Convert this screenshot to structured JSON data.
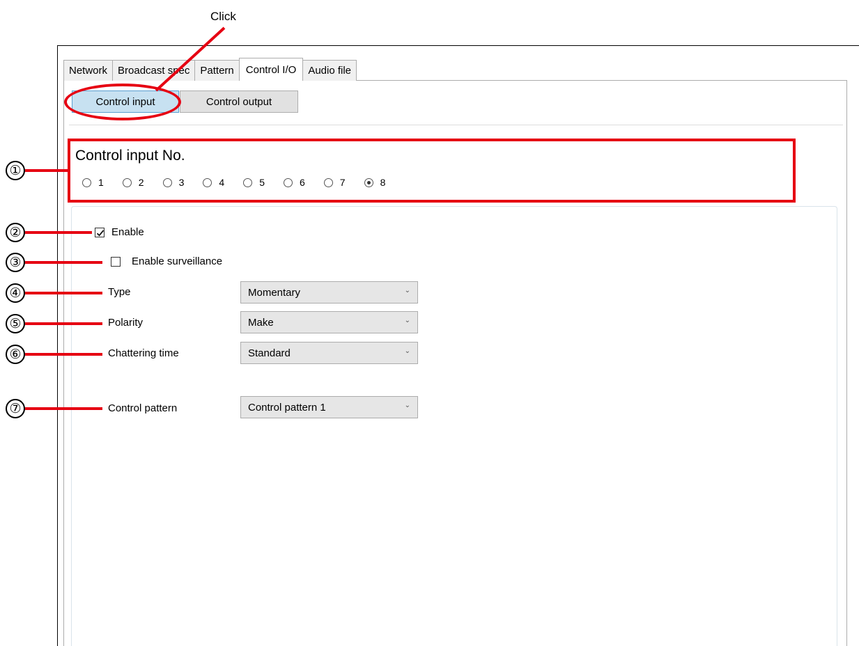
{
  "annotation": {
    "click_label": "Click",
    "callouts": [
      "①",
      "②",
      "③",
      "④",
      "⑤",
      "⑥",
      "⑦"
    ],
    "accent_color": "#e60012"
  },
  "tabs": [
    {
      "label": "Network"
    },
    {
      "label": "Broadcast spec"
    },
    {
      "label": "Pattern"
    },
    {
      "label": "Control I/O",
      "active": true
    },
    {
      "label": "Audio file"
    }
  ],
  "subtabs": {
    "control_input": "Control input",
    "control_output": "Control output",
    "active": "control_input"
  },
  "control_input": {
    "title": "Control input No.",
    "options": [
      "1",
      "2",
      "3",
      "4",
      "5",
      "6",
      "7",
      "8"
    ],
    "selected": "8"
  },
  "settings": {
    "enable": {
      "label": "Enable",
      "checked": true
    },
    "surveillance": {
      "label": "Enable surveillance",
      "checked": false
    },
    "type": {
      "label": "Type",
      "value": "Momentary"
    },
    "polarity": {
      "label": "Polarity",
      "value": "Make"
    },
    "chattering": {
      "label": "Chattering time",
      "value": "Standard"
    },
    "pattern": {
      "label": "Control pattern",
      "value": "Control pattern 1"
    }
  },
  "icons": {
    "dropdown": "chevron-down-icon",
    "check": "checkmark-icon"
  }
}
